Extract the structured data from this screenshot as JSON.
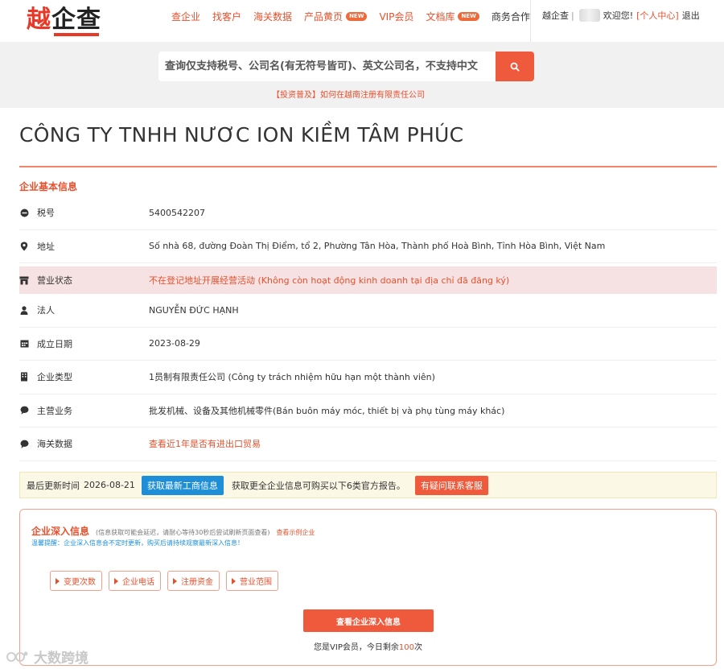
{
  "header": {
    "logo_text_a": "越",
    "logo_text_b": "企查",
    "nav": [
      {
        "label": "查企业",
        "badge": ""
      },
      {
        "label": "找客户",
        "badge": ""
      },
      {
        "label": "海关数据",
        "badge": ""
      },
      {
        "label": "产品黄页",
        "badge": "NEW"
      },
      {
        "label": "VIP会员",
        "badge": ""
      },
      {
        "label": "文档库",
        "badge": "NEW"
      },
      {
        "label": "商务合作",
        "badge": ""
      }
    ],
    "user": {
      "brand": "越企查",
      "separator": "|",
      "welcome": "欢迎您!",
      "center_link": "[个人中心]",
      "logout": "退出"
    }
  },
  "search": {
    "placeholder": "查询仅支持税号、公司名(有无符号皆可)、英文公司名，不支持中文",
    "button_icon": "search-icon",
    "hint": "【投资普及】如何在越南注册有限责任公司"
  },
  "company": {
    "name": "CÔNG TY TNHH NƯƠC ION KIỀM TÂM PHÚC"
  },
  "basic_info": {
    "section_title": "企业基本信息",
    "rows": [
      {
        "icon": "tax-id-icon",
        "label": "税号",
        "value": "5400542207",
        "style": ""
      },
      {
        "icon": "location-icon",
        "label": "地址",
        "value": "Số nhà 68, đường Đoàn Thị Điểm, tổ 2, Phường Tân Hòa, Thành phố Hoà Bình, Tỉnh Hòa Bình, Việt Nam",
        "style": ""
      },
      {
        "icon": "store-icon",
        "label": "营业状态",
        "value": "不在登记地址开展经营活动 (Không còn hoạt động kinh doanh tại địa chỉ đã đăng ký)",
        "style": "red"
      },
      {
        "icon": "person-icon",
        "label": "法人",
        "value": "NGUYỄN ĐỨC HẠNH",
        "style": ""
      },
      {
        "icon": "calendar-icon",
        "label": "成立日期",
        "value": "2023-08-29",
        "style": ""
      },
      {
        "icon": "building-icon",
        "label": "企业类型",
        "value": "1员制有限责任公司 (Công ty trách nhiệm hữu hạn một thành viên)",
        "style": ""
      },
      {
        "icon": "chat-icon",
        "label": "主营业务",
        "value": "批发机械、设备及其他机械零件(Bán buôn máy móc, thiết bị và phụ tùng máy khác)",
        "style": ""
      },
      {
        "icon": "chat-icon",
        "label": "海关数据",
        "value": "查看近1年是否有进出口贸易",
        "style": "link"
      }
    ]
  },
  "update_bar": {
    "label": "最后更新时间",
    "date": "2026-08-21",
    "refresh_button": "获取最新工商信息",
    "more_text": "获取更全企业信息可购买以下6类官方报告。",
    "service_button": "有疑问联系客服"
  },
  "deep_info": {
    "title": "企业深入信息",
    "note": "(信息获取可能会延迟，请耐心等待30秒后尝试刷新页面查看)",
    "example_link": "查看示例企业",
    "tip": "温馨提醒：企业深入信息会不定时更新，购买后请持续观察最新深入信息！",
    "chips": [
      "变更次数",
      "企业电话",
      "注册资金",
      "营业范围"
    ],
    "view_button": "查看企业深入信息",
    "vip_prefix": "您是VIP会员，今日剩余",
    "vip_count": "100",
    "vip_suffix": "次"
  },
  "watermark": {
    "text": "大数跨境"
  }
}
